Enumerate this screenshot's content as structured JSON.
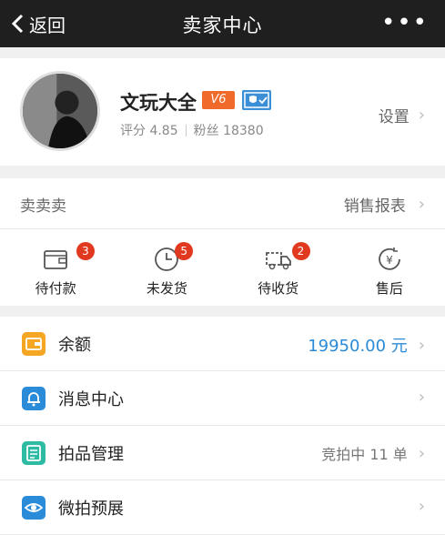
{
  "header": {
    "back_label": "返回",
    "title": "卖家中心"
  },
  "profile": {
    "name": "文玩大全",
    "vip_badge": "V6",
    "rating": "评分 4.85",
    "fans": "粉丝 18380",
    "settings_label": "设置"
  },
  "sales": {
    "left_label": "卖卖卖",
    "right_label": "销售报表"
  },
  "orders": [
    {
      "label": "待付款",
      "count": "3",
      "icon": "wallet-icon"
    },
    {
      "label": "未发货",
      "count": "5",
      "icon": "clock-icon"
    },
    {
      "label": "待收货",
      "count": "2",
      "icon": "truck-icon"
    },
    {
      "label": "售后",
      "count": "",
      "icon": "refund-yen-icon"
    }
  ],
  "menu": [
    {
      "label": "余额",
      "value": "19950.00 元",
      "icon": "wallet-icon",
      "color": "#f5a623"
    },
    {
      "label": "消息中心",
      "value": "",
      "icon": "bell-icon",
      "color": "#2a8bd8"
    },
    {
      "label": "拍品管理",
      "value": "竞拍中 11 单",
      "icon": "auction-list-icon",
      "color": "#2dbba4"
    },
    {
      "label": "微拍预展",
      "value": "",
      "icon": "eye-icon",
      "color": "#2a8bd8"
    }
  ],
  "colors": {
    "header_bg": "#1f1f1f",
    "badge_red": "#e0391f",
    "balance_blue": "#2a8bd8"
  }
}
